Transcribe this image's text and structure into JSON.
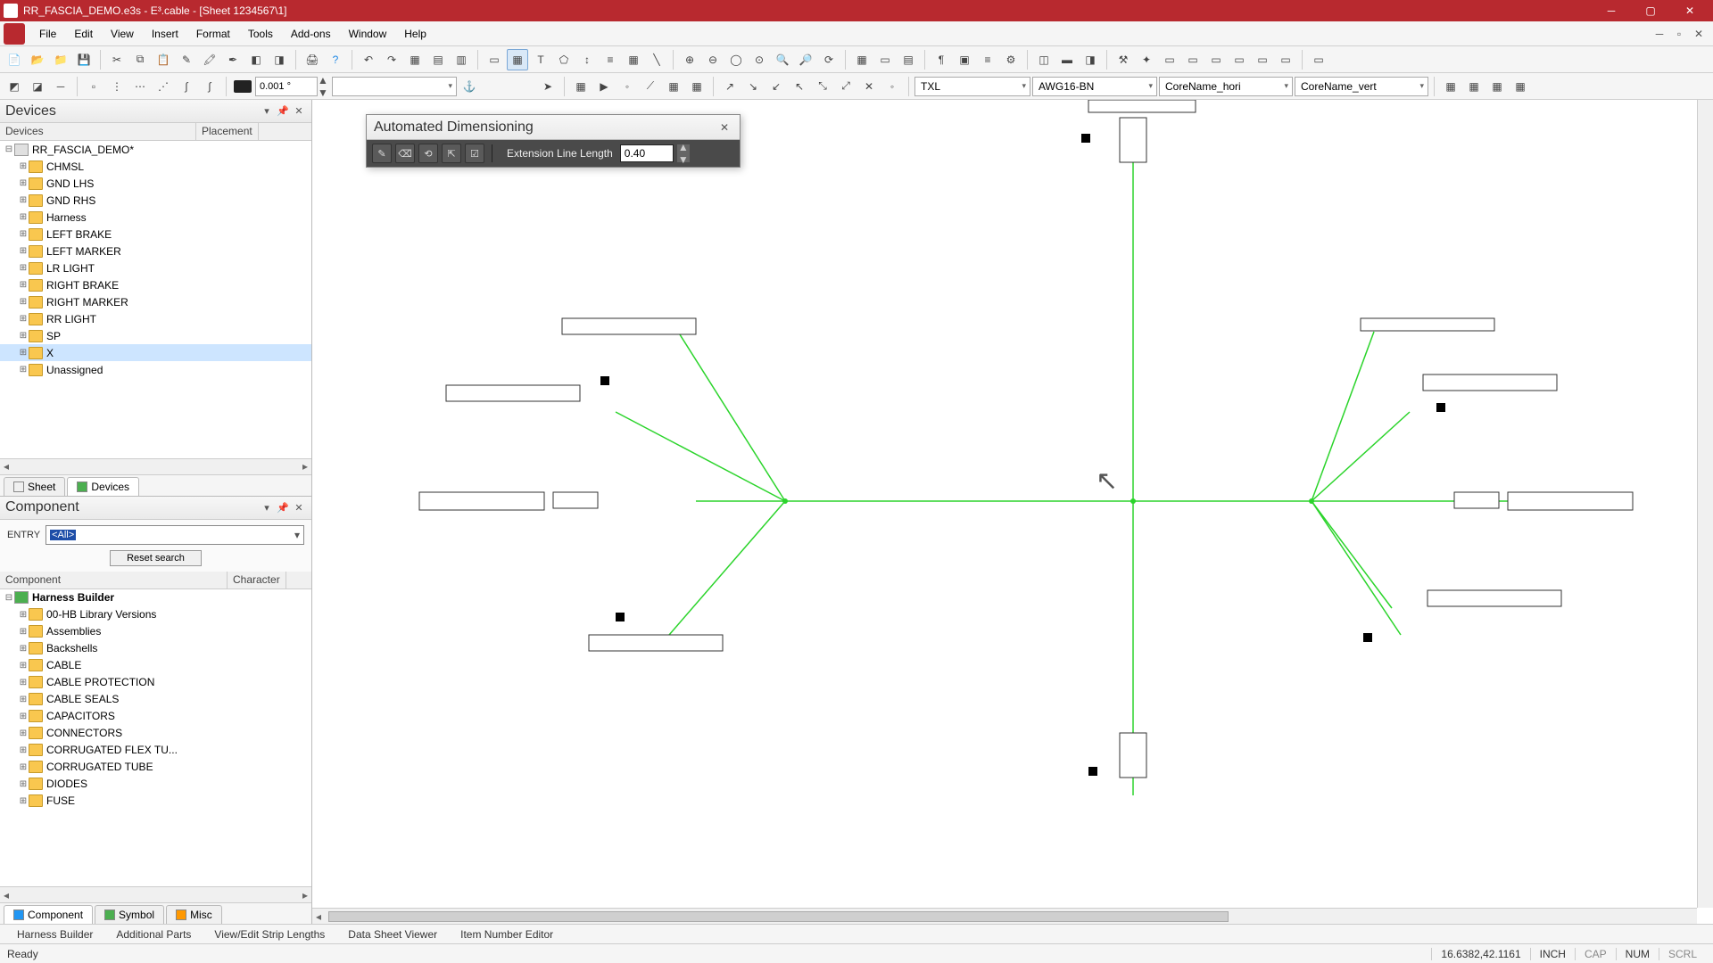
{
  "window": {
    "title": "RR_FASCIA_DEMO.e3s - E³.cable - [Sheet 1234567\\1]"
  },
  "menu": [
    "File",
    "Edit",
    "View",
    "Insert",
    "Format",
    "Tools",
    "Add-ons",
    "Window",
    "Help"
  ],
  "toolbar2": {
    "precision": "0.001 °",
    "combo1": "TXL",
    "combo2": "AWG16-BN",
    "combo3": "CoreName_hori",
    "combo4": "CoreName_vert"
  },
  "devices_panel": {
    "title": "Devices",
    "col1": "Devices",
    "col2": "Placement",
    "root": "RR_FASCIA_DEMO*",
    "items": [
      "CHMSL",
      "GND LHS",
      "GND RHS",
      "Harness",
      "LEFT BRAKE",
      "LEFT MARKER",
      "LR LIGHT",
      "RIGHT BRAKE",
      "RIGHT MARKER",
      "RR LIGHT",
      "SP",
      "X",
      "Unassigned"
    ],
    "tabs": [
      "Sheet",
      "Devices"
    ]
  },
  "component_panel": {
    "title": "Component",
    "entry_label": "ENTRY",
    "entry_value": "<All>",
    "reset": "Reset search",
    "col1": "Component",
    "col2": "Character",
    "root": "Harness Builder",
    "items": [
      "00-HB Library Versions",
      "Assemblies",
      "Backshells",
      "CABLE",
      "CABLE PROTECTION",
      "CABLE SEALS",
      "CAPACITORS",
      "CONNECTORS",
      "CORRUGATED FLEX TU...",
      "CORRUGATED TUBE",
      "DIODES",
      "FUSE"
    ],
    "tabs": [
      "Component",
      "Symbol",
      "Misc"
    ]
  },
  "dialog": {
    "title": "Automated Dimensioning",
    "ext_label": "Extension Line Length",
    "ext_value": "0.40"
  },
  "bottom_tabs": [
    "Harness Builder",
    "Additional Parts",
    "View/Edit Strip Lengths",
    "Data Sheet Viewer",
    "Item Number Editor"
  ],
  "status": {
    "ready": "Ready",
    "coords": "16.6382,42.1161",
    "unit": "INCH",
    "cap": "CAP",
    "num": "NUM",
    "scrl": "SCRL"
  }
}
